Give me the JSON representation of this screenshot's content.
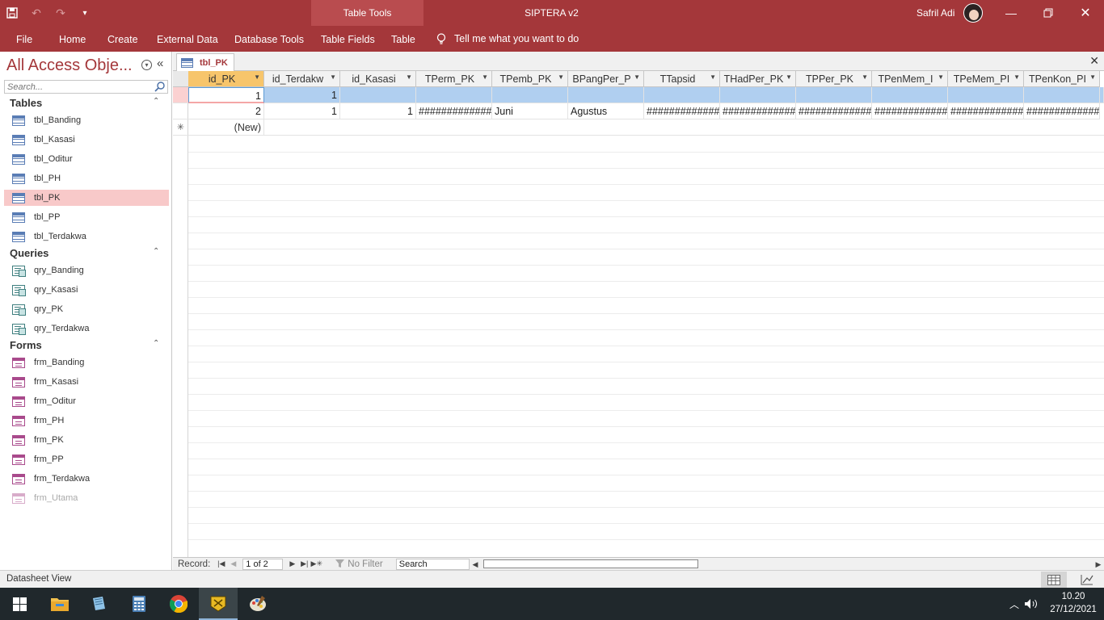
{
  "titlebar": {
    "context_label": "Table Tools",
    "app_title": "SIPTERA v2",
    "user_name": "Safril Adi"
  },
  "ribbon": {
    "tabs": [
      "File",
      "Home",
      "Create",
      "External Data",
      "Database Tools",
      "Table Fields",
      "Table"
    ],
    "tell_me": "Tell me what you want to do"
  },
  "nav": {
    "title": "All Access Obje...",
    "search_placeholder": "Search...",
    "groups": {
      "tables": {
        "title": "Tables",
        "items": [
          "tbl_Banding",
          "tbl_Kasasi",
          "tbl_Oditur",
          "tbl_PH",
          "tbl_PK",
          "tbl_PP",
          "tbl_Terdakwa"
        ]
      },
      "queries": {
        "title": "Queries",
        "items": [
          "qry_Banding",
          "qry_Kasasi",
          "qry_PK",
          "qry_Terdakwa"
        ]
      },
      "forms": {
        "title": "Forms",
        "items": [
          "frm_Banding",
          "frm_Kasasi",
          "frm_Oditur",
          "frm_PH",
          "frm_PK",
          "frm_PP",
          "frm_Terdakwa",
          "frm_Utama"
        ]
      }
    }
  },
  "document": {
    "tab_label": "tbl_PK"
  },
  "datasheet": {
    "columns": [
      "id_PK",
      "id_Terdakw",
      "id_Kasasi",
      "TPerm_PK",
      "TPemb_PK",
      "BPangPer_P",
      "TTapsid",
      "THadPer_PK",
      "TPPer_PK",
      "TPenMem_I",
      "TPeMem_PI",
      "TPenKon_PI"
    ],
    "rows": [
      [
        "1",
        "1",
        "",
        "",
        "",
        "",
        "",
        "",
        "",
        "",
        "",
        ""
      ],
      [
        "2",
        "1",
        "1",
        "##############",
        "Juni",
        "Agustus",
        "##############",
        "##############",
        "##############",
        "##############",
        "##############",
        "##############"
      ]
    ],
    "new_record_label": "(New)",
    "new_row_marker": "✳"
  },
  "record_nav": {
    "label": "Record:",
    "position": "1 of 2",
    "filter": "No Filter",
    "search": "Search"
  },
  "status": {
    "view_text": "Datasheet View"
  },
  "taskbar": {
    "time": "10.20",
    "date": "27/12/2021"
  },
  "colors": {
    "accent": "#a4373a",
    "selected_nav": "#f8c9c9",
    "active_header": "#f7c56b",
    "selected_row": "#b0cff0"
  }
}
